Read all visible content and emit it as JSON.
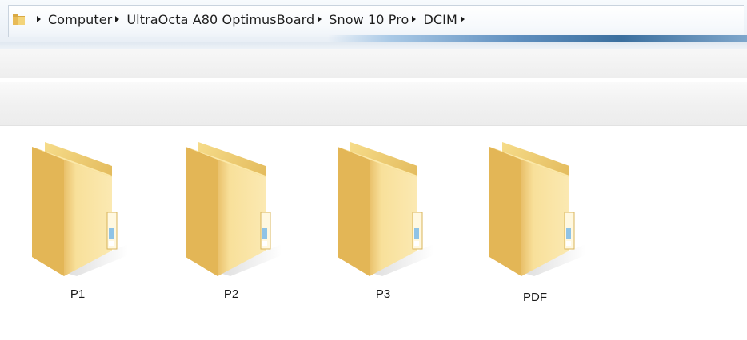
{
  "addressbar": {
    "icon": "folder-icon",
    "crumbs": [
      {
        "label": "Computer"
      },
      {
        "label": "UltraOcta A80 OptimusBoard"
      },
      {
        "label": "Snow 10 Pro"
      },
      {
        "label": "DCIM"
      }
    ]
  },
  "folders": [
    {
      "label": "P1",
      "icon": "folder-icon"
    },
    {
      "label": "P2",
      "icon": "folder-icon"
    },
    {
      "label": "P3",
      "icon": "folder-icon"
    },
    {
      "label": "PDF",
      "icon": "folder-icon"
    }
  ],
  "colors": {
    "folder": "#f2cf6a",
    "folder_dark": "#e0b24a",
    "accent": "#3b6f9e"
  }
}
